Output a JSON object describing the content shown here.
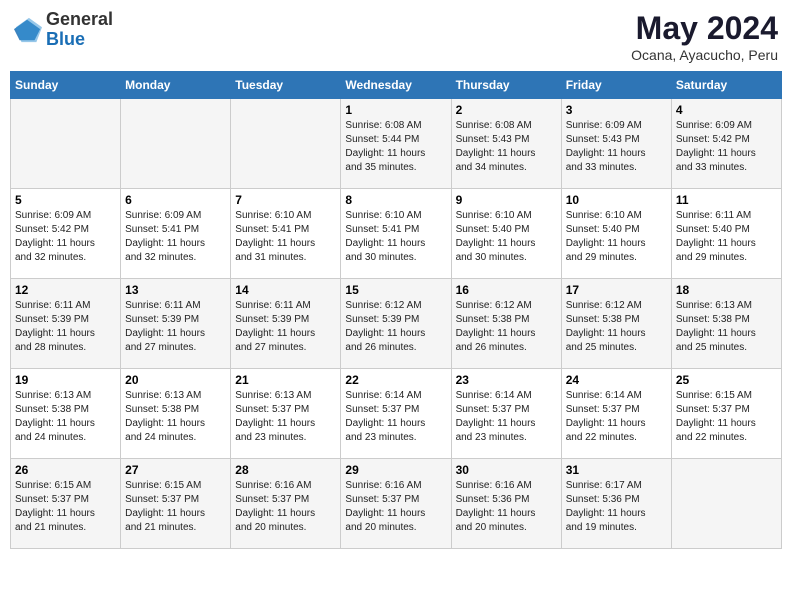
{
  "header": {
    "logo_general": "General",
    "logo_blue": "Blue",
    "month_year": "May 2024",
    "location": "Ocana, Ayacucho, Peru"
  },
  "days_of_week": [
    "Sunday",
    "Monday",
    "Tuesday",
    "Wednesday",
    "Thursday",
    "Friday",
    "Saturday"
  ],
  "weeks": [
    [
      {
        "day": "",
        "info": ""
      },
      {
        "day": "",
        "info": ""
      },
      {
        "day": "",
        "info": ""
      },
      {
        "day": "1",
        "info": "Sunrise: 6:08 AM\nSunset: 5:44 PM\nDaylight: 11 hours\nand 35 minutes."
      },
      {
        "day": "2",
        "info": "Sunrise: 6:08 AM\nSunset: 5:43 PM\nDaylight: 11 hours\nand 34 minutes."
      },
      {
        "day": "3",
        "info": "Sunrise: 6:09 AM\nSunset: 5:43 PM\nDaylight: 11 hours\nand 33 minutes."
      },
      {
        "day": "4",
        "info": "Sunrise: 6:09 AM\nSunset: 5:42 PM\nDaylight: 11 hours\nand 33 minutes."
      }
    ],
    [
      {
        "day": "5",
        "info": "Sunrise: 6:09 AM\nSunset: 5:42 PM\nDaylight: 11 hours\nand 32 minutes."
      },
      {
        "day": "6",
        "info": "Sunrise: 6:09 AM\nSunset: 5:41 PM\nDaylight: 11 hours\nand 32 minutes."
      },
      {
        "day": "7",
        "info": "Sunrise: 6:10 AM\nSunset: 5:41 PM\nDaylight: 11 hours\nand 31 minutes."
      },
      {
        "day": "8",
        "info": "Sunrise: 6:10 AM\nSunset: 5:41 PM\nDaylight: 11 hours\nand 30 minutes."
      },
      {
        "day": "9",
        "info": "Sunrise: 6:10 AM\nSunset: 5:40 PM\nDaylight: 11 hours\nand 30 minutes."
      },
      {
        "day": "10",
        "info": "Sunrise: 6:10 AM\nSunset: 5:40 PM\nDaylight: 11 hours\nand 29 minutes."
      },
      {
        "day": "11",
        "info": "Sunrise: 6:11 AM\nSunset: 5:40 PM\nDaylight: 11 hours\nand 29 minutes."
      }
    ],
    [
      {
        "day": "12",
        "info": "Sunrise: 6:11 AM\nSunset: 5:39 PM\nDaylight: 11 hours\nand 28 minutes."
      },
      {
        "day": "13",
        "info": "Sunrise: 6:11 AM\nSunset: 5:39 PM\nDaylight: 11 hours\nand 27 minutes."
      },
      {
        "day": "14",
        "info": "Sunrise: 6:11 AM\nSunset: 5:39 PM\nDaylight: 11 hours\nand 27 minutes."
      },
      {
        "day": "15",
        "info": "Sunrise: 6:12 AM\nSunset: 5:39 PM\nDaylight: 11 hours\nand 26 minutes."
      },
      {
        "day": "16",
        "info": "Sunrise: 6:12 AM\nSunset: 5:38 PM\nDaylight: 11 hours\nand 26 minutes."
      },
      {
        "day": "17",
        "info": "Sunrise: 6:12 AM\nSunset: 5:38 PM\nDaylight: 11 hours\nand 25 minutes."
      },
      {
        "day": "18",
        "info": "Sunrise: 6:13 AM\nSunset: 5:38 PM\nDaylight: 11 hours\nand 25 minutes."
      }
    ],
    [
      {
        "day": "19",
        "info": "Sunrise: 6:13 AM\nSunset: 5:38 PM\nDaylight: 11 hours\nand 24 minutes."
      },
      {
        "day": "20",
        "info": "Sunrise: 6:13 AM\nSunset: 5:38 PM\nDaylight: 11 hours\nand 24 minutes."
      },
      {
        "day": "21",
        "info": "Sunrise: 6:13 AM\nSunset: 5:37 PM\nDaylight: 11 hours\nand 23 minutes."
      },
      {
        "day": "22",
        "info": "Sunrise: 6:14 AM\nSunset: 5:37 PM\nDaylight: 11 hours\nand 23 minutes."
      },
      {
        "day": "23",
        "info": "Sunrise: 6:14 AM\nSunset: 5:37 PM\nDaylight: 11 hours\nand 23 minutes."
      },
      {
        "day": "24",
        "info": "Sunrise: 6:14 AM\nSunset: 5:37 PM\nDaylight: 11 hours\nand 22 minutes."
      },
      {
        "day": "25",
        "info": "Sunrise: 6:15 AM\nSunset: 5:37 PM\nDaylight: 11 hours\nand 22 minutes."
      }
    ],
    [
      {
        "day": "26",
        "info": "Sunrise: 6:15 AM\nSunset: 5:37 PM\nDaylight: 11 hours\nand 21 minutes."
      },
      {
        "day": "27",
        "info": "Sunrise: 6:15 AM\nSunset: 5:37 PM\nDaylight: 11 hours\nand 21 minutes."
      },
      {
        "day": "28",
        "info": "Sunrise: 6:16 AM\nSunset: 5:37 PM\nDaylight: 11 hours\nand 20 minutes."
      },
      {
        "day": "29",
        "info": "Sunrise: 6:16 AM\nSunset: 5:37 PM\nDaylight: 11 hours\nand 20 minutes."
      },
      {
        "day": "30",
        "info": "Sunrise: 6:16 AM\nSunset: 5:36 PM\nDaylight: 11 hours\nand 20 minutes."
      },
      {
        "day": "31",
        "info": "Sunrise: 6:17 AM\nSunset: 5:36 PM\nDaylight: 11 hours\nand 19 minutes."
      },
      {
        "day": "",
        "info": ""
      }
    ]
  ]
}
